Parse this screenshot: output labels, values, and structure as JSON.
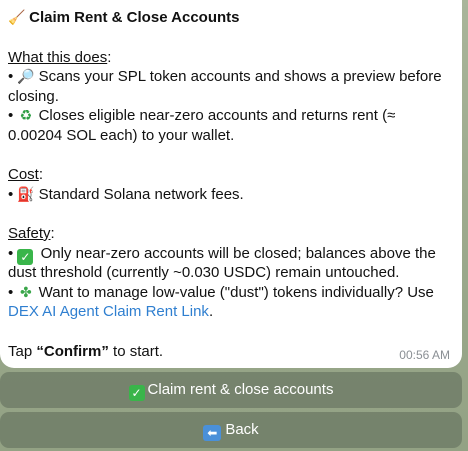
{
  "message": {
    "title_icon": "broom-icon",
    "title": "Claim Rent & Close Accounts",
    "section_what": "What this does",
    "what_1_icon": "magnifier-icon",
    "what_1a": "Scans your SPL token accounts and shows a preview before",
    "what_1b": "closing.",
    "what_2_icon": "recycle-icon",
    "what_2a": "Closes eligible near-zero accounts and returns rent (≈",
    "what_2b": "0.00204 SOL each) to your wallet.",
    "section_cost": "Cost",
    "cost_1_icon": "fuel-pump-icon",
    "cost_1": "Standard Solana network fees.",
    "section_safety": "Safety",
    "safety_1_icon": "check-mark-icon",
    "safety_1a": "Only near-zero accounts will be closed; balances above the",
    "safety_1b": "dust threshold (currently ~0.030 USDC) remain untouched.",
    "safety_2_icon": "puzzle-icon",
    "safety_2a": "Want to manage low-value (\"dust\") tokens individually? Use",
    "safety_2_link": "DEX AI Agent Claim Rent Link",
    "safety_2_end": ".",
    "tap_prefix": "Tap ",
    "tap_bold": "“Confirm”",
    "tap_suffix": " to start.",
    "time": "00:56 AM"
  },
  "buttons": {
    "claim_label": "Claim rent & close accounts",
    "back_label": "Back"
  }
}
